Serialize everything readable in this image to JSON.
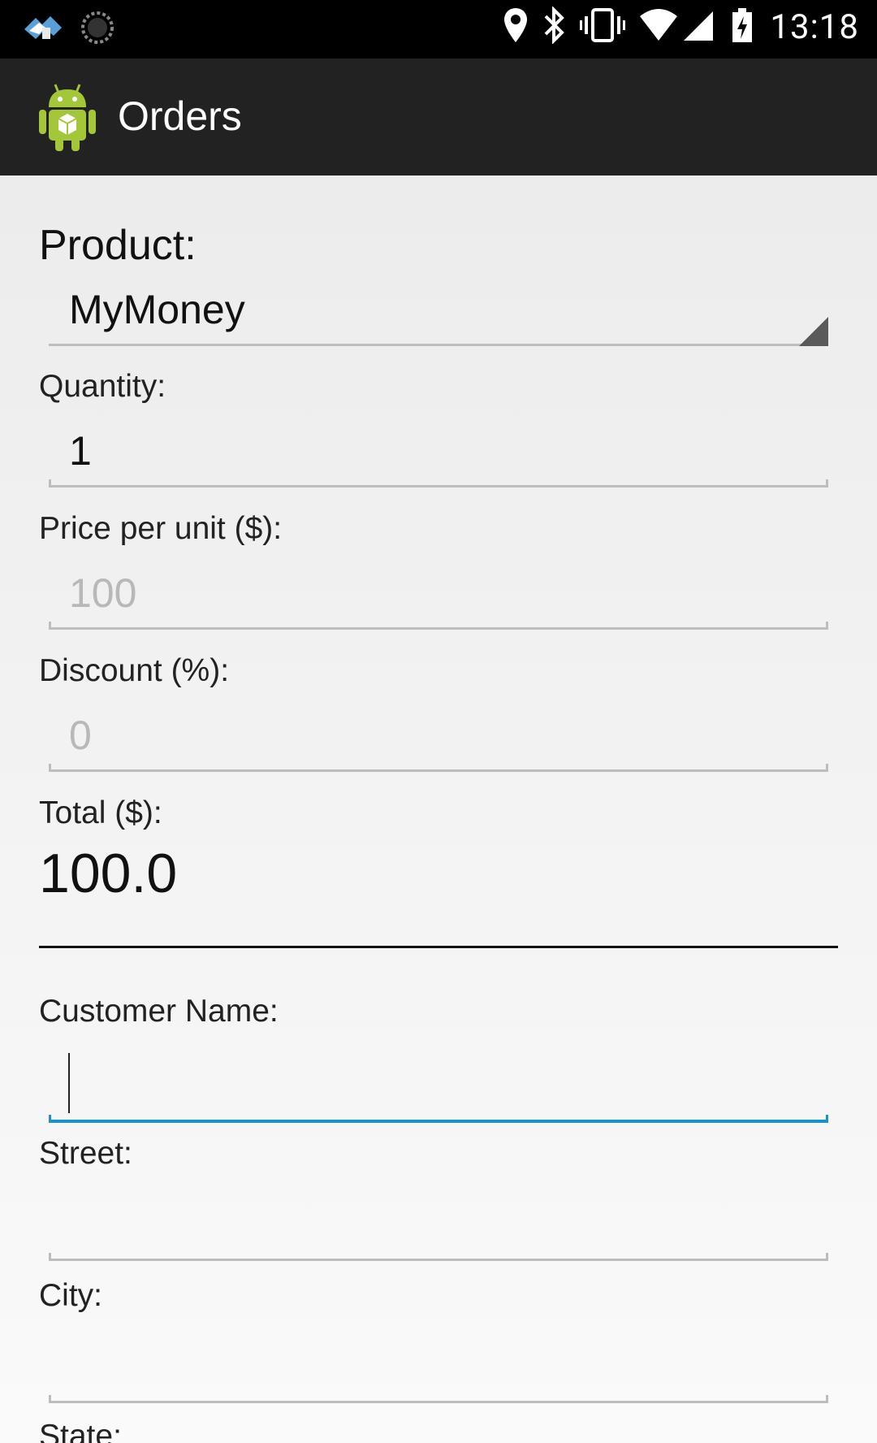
{
  "status_bar": {
    "time": "13:18",
    "icons": [
      "notification-app-icon",
      "sync-icon",
      "location-icon",
      "bluetooth-icon",
      "vibrate-icon",
      "wifi-icon",
      "cell-signal-icon",
      "battery-charging-icon"
    ]
  },
  "action_bar": {
    "title": "Orders",
    "icon": "android-app-icon"
  },
  "form": {
    "product_label": "Product:",
    "product_value": "MyMoney",
    "quantity_label": "Quantity:",
    "quantity_value": "1",
    "price_label": "Price per unit ($):",
    "price_value": "100",
    "discount_label": "Discount (%):",
    "discount_value": "0",
    "total_label": "Total ($):",
    "total_value": "100.0",
    "customer_name_label": "Customer Name:",
    "customer_name_value": "",
    "street_label": "Street:",
    "street_value": "",
    "city_label": "City:",
    "city_value": "",
    "state_label": "State:"
  },
  "colors": {
    "status_bar_bg": "#000000",
    "action_bar_bg": "#222222",
    "focus_accent": "#1e90c8"
  }
}
